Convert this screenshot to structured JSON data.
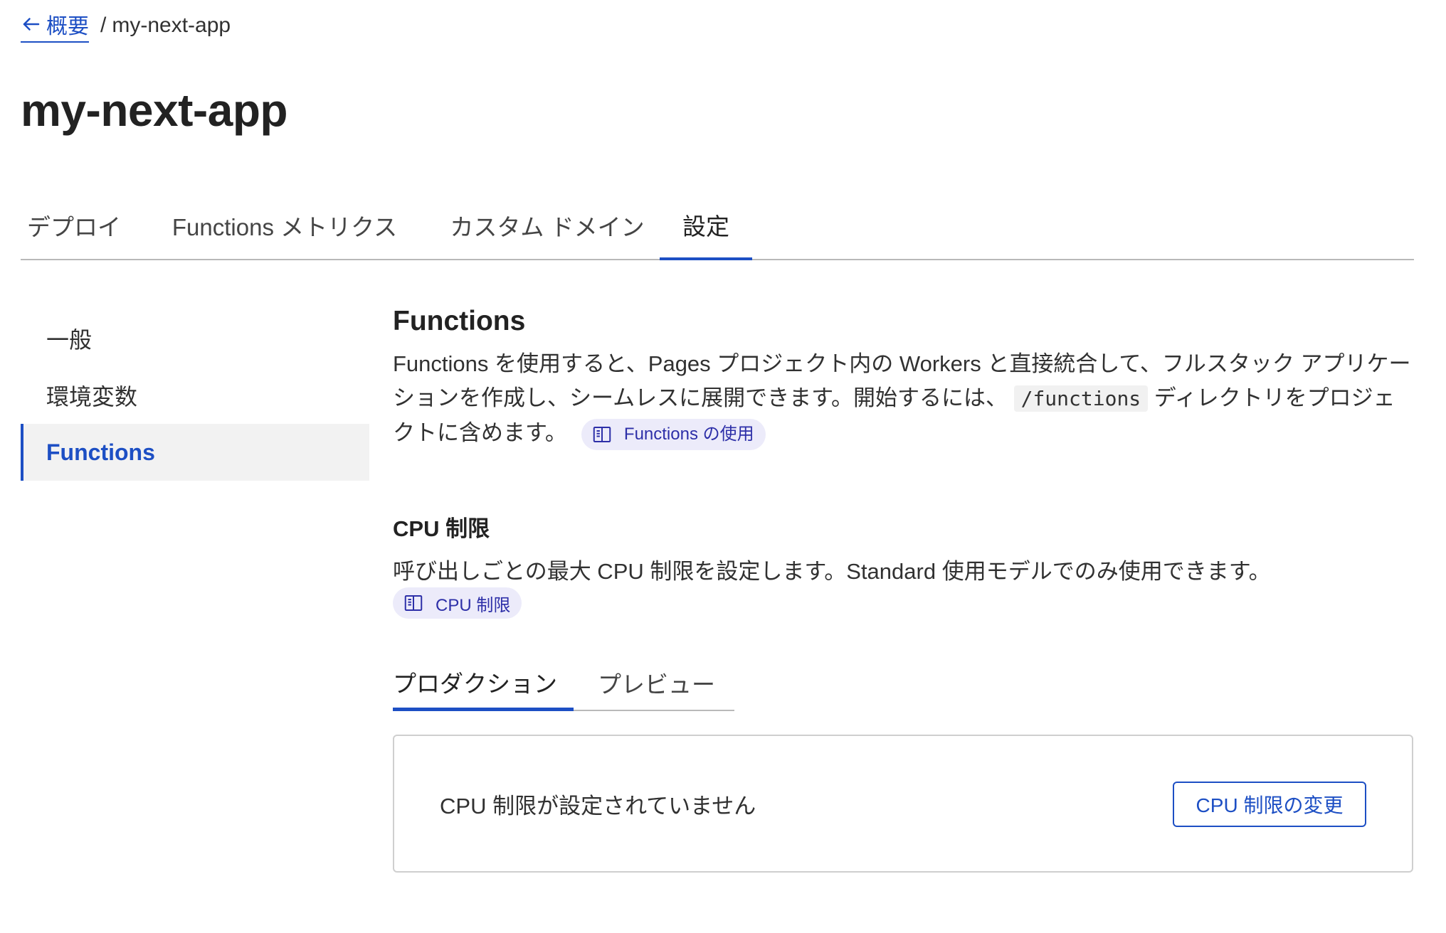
{
  "breadcrumb": {
    "back_label": "概要",
    "separator": "/",
    "current": "my-next-app"
  },
  "page_title": "my-next-app",
  "tabs": [
    {
      "label": "デプロイ"
    },
    {
      "label": "Functions メトリクス"
    },
    {
      "label": "カスタム ドメイン"
    },
    {
      "label": "設定",
      "active": true
    }
  ],
  "sidebar": {
    "items": [
      {
        "label": "一般"
      },
      {
        "label": "環境変数"
      },
      {
        "label": "Functions",
        "active": true
      }
    ]
  },
  "functions_section": {
    "title": "Functions",
    "desc_part1": "Functions を使用すると、Pages プロジェクト内の Workers と直接統合して、フルスタック アプリケーションを作成し、シームレスに展開できます。開始するには、",
    "code": "/functions",
    "desc_part2": "ディレクトリをプロジェクトに含めます。",
    "doc_link": "Functions の使用"
  },
  "cpu_section": {
    "title": "CPU 制限",
    "description": "呼び出しごとの最大 CPU 制限を設定します。Standard 使用モデルでのみ使用できます。",
    "doc_link": "CPU 制限",
    "tabs": [
      {
        "label": "プロダクション",
        "active": true
      },
      {
        "label": "プレビュー"
      }
    ],
    "status_text": "CPU 制限が設定されていません",
    "change_button": "CPU 制限の変更"
  },
  "colors": {
    "accent": "#1d4fc4",
    "pill_bg": "#ecebfa",
    "pill_text": "#2d2fa8",
    "sidebar_active_bg": "#f2f2f2"
  },
  "icons": {
    "back": "arrow-left-icon",
    "doc": "book-icon"
  }
}
